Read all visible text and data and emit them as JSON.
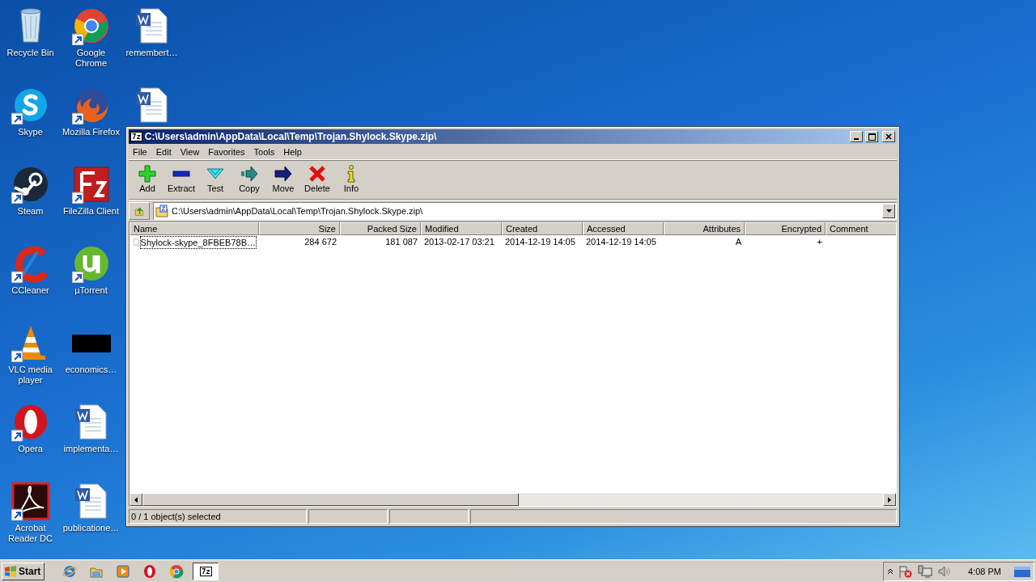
{
  "desktop_icons": [
    {
      "kind": "recycle",
      "label": "Recycle Bin",
      "shortcut": false
    },
    {
      "kind": "skype",
      "label": "Skype",
      "shortcut": true
    },
    {
      "kind": "steam",
      "label": "Steam",
      "shortcut": true
    },
    {
      "kind": "ccleaner",
      "label": "CCleaner",
      "shortcut": true
    },
    {
      "kind": "vlc",
      "label": "VLC media player",
      "shortcut": true
    },
    {
      "kind": "opera",
      "label": "Opera",
      "shortcut": true
    },
    {
      "kind": "acrobat",
      "label": "Acrobat Reader DC",
      "shortcut": true
    },
    {
      "kind": "chrome",
      "label": "Google Chrome",
      "shortcut": true
    },
    {
      "kind": "firefox",
      "label": "Mozilla Firefox",
      "shortcut": true
    },
    {
      "kind": "filezilla",
      "label": "FileZilla Client",
      "shortcut": true
    },
    {
      "kind": "utorrent",
      "label": "µTorrent",
      "shortcut": true
    },
    {
      "kind": "blank",
      "label": "economics…",
      "shortcut": false
    },
    {
      "kind": "word",
      "label": "implementa…",
      "shortcut": false
    },
    {
      "kind": "word",
      "label": "publicatione…",
      "shortcut": false
    },
    {
      "kind": "word",
      "label": "remembert…",
      "shortcut": false
    },
    {
      "kind": "word",
      "shortcut": false
    }
  ],
  "window": {
    "icon_label": "7z",
    "title": "C:\\Users\\admin\\AppData\\Local\\Temp\\Trojan.Shylock.Skype.zip\\",
    "menu": [
      "File",
      "Edit",
      "View",
      "Favorites",
      "Tools",
      "Help"
    ],
    "toolbar": [
      {
        "kind": "add",
        "label": "Add"
      },
      {
        "kind": "extract",
        "label": "Extract"
      },
      {
        "kind": "test",
        "label": "Test"
      },
      {
        "kind": "copy",
        "label": "Copy"
      },
      {
        "kind": "move",
        "label": "Move"
      },
      {
        "kind": "delete",
        "label": "Delete"
      },
      {
        "kind": "info",
        "label": "Info"
      }
    ],
    "address": "C:\\Users\\admin\\AppData\\Local\\Temp\\Trojan.Shylock.Skype.zip\\",
    "table": {
      "columns": [
        "Name",
        "Size",
        "Packed Size",
        "Modified",
        "Created",
        "Accessed",
        "Attributes",
        "Encrypted",
        "Comment"
      ],
      "rows": [
        {
          "focused": true,
          "selected": false,
          "cells": [
            "Shylock-skype_8FBEB78B…",
            "284 672",
            "181 087",
            "2013-02-17 03:21",
            "2014-12-19 14:05",
            "2014-12-19 14:05",
            "A",
            "+"
          ]
        }
      ]
    },
    "status_bar": "0 / 1 object(s) selected"
  },
  "taskbar": {
    "start": "Start",
    "items": [
      {
        "kind": "ie",
        "active": false
      },
      {
        "kind": "explorer",
        "active": false
      },
      {
        "kind": "media",
        "active": false
      },
      {
        "kind": "opera",
        "active": false
      },
      {
        "kind": "chrome",
        "active": false
      },
      {
        "kind": "sevenzip",
        "label": "7z",
        "active": true
      }
    ],
    "clock": "4:08 PM"
  }
}
